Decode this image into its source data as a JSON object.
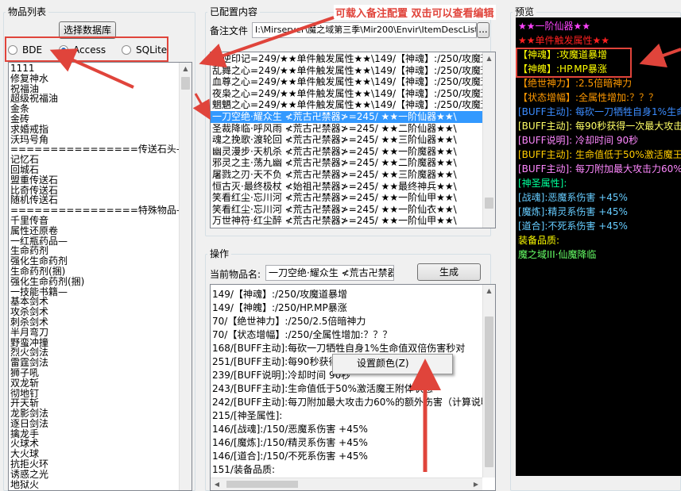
{
  "left": {
    "title": "物品列表",
    "select_db_label": "选择数据库",
    "radios": [
      {
        "label": "BDE",
        "checked": false
      },
      {
        "label": "Access",
        "checked": true
      },
      {
        "label": "SQLite",
        "checked": false
      }
    ],
    "items": [
      "1111",
      "修复神水",
      "祝福油",
      "超级祝福油",
      "金条",
      "金砖",
      "求婚戒指",
      "沃玛号角",
      "================传送石头—",
      "记忆石",
      "回城石",
      "盟重传送石",
      "比奇传送石",
      "随机传送石",
      "================特殊物品—",
      "千里传音",
      "属性还原卷",
      "一红瓶药品—",
      "生命药剂",
      "强化生命药剂",
      "生命药剂(捆)",
      "强化生命药剂(捆)",
      "一技能书籍—",
      "基本剑术",
      "攻杀剑术",
      "刺杀剑术",
      "半月弯刀",
      "野蛮冲撞",
      "烈火剑法",
      "雷霆剑法",
      "狮子吼",
      "双龙斩",
      "彻地钉",
      "开天斩",
      "龙影剑法",
      "逐日剑法",
      "擒龙手",
      "火球术",
      "大火球",
      "抗拒火环",
      "诱惑之光",
      "地狱火"
    ]
  },
  "config": {
    "title": "已配置内容",
    "annotation": "可载入备注配置 双击可以查看编辑",
    "file_label": "备注文件",
    "file_path": "I:\\Mirserver\\魔之域第三季\\Mir200\\Envir\\ItemDescList.txt",
    "browse_label": "...",
    "rows": [
      "天逆印记=249/★★单件触发属性★★\\149/【神魂】:/250/攻魔道",
      "乱舞之心=249/★★单件触发属性★★\\149/【神魂】:/250/攻魔道",
      "血尊之心=249/★★单件触发属性★★\\149/【神魂】:/250/攻魔道",
      "夜枭之心=249/★★单件触发属性★★\\149/【神魂】:/250/攻魔道",
      "魍魉之心=249/★★单件触发属性★★\\149/【神魂】:/250/攻魔道",
      "一刀空绝·耀众生 ≮荒古卍禁器≯=245/      ★★一阶仙器★★\\",
      "圣裁降临·呼风雨 ≮荒古卍禁器≯=245/      ★★二阶仙器★★\\",
      "魂之挽歌·渡轮回 ≮荒古卍禁器≯=245/      ★★三阶仙器★★\\",
      "幽灵漫步·天机杀 ≮荒古卍禁器≯=245/      ★★一阶魔器★★\\",
      "邪灵之主·荡九幽 ≮荒古卍禁器≯=245/      ★★二阶魔器★★\\",
      "屠戮之刃·天不负 ≮荒古卍禁器≯=245/      ★★三阶魔器★★\\",
      "恒古灭·最终极杖 ≮始祖卍禁器≯=245/      ★★最终神兵★★\\",
      "笑看红尘·忘川河 ≮荒古卍禁器≯=245/      ★★一阶仙甲★★\\",
      "笑看红尘·忘川河 ≮荒古卍禁器≯=245/      ★★一阶仙衣★★\\",
      "万世神符·红尘醉 ≮荒古卍禁器≯=245/      ★★一阶仙甲★★\\"
    ],
    "selected_index": 5
  },
  "ops": {
    "title": "操作",
    "current_label": "当前物品名:",
    "current_value": "一刀空绝·耀众生 ≮荒古卍禁器",
    "generate_label": "生成",
    "lines": [
      "149/【神魂】:/250/攻魔道暴增",
      "149/【神魄】:/250/HP.MP暴涨",
      "70/【绝世神力】:/250/2.5倍暗神力",
      "70/【状态增幅】:/250/全属性增加:？？？",
      "168/[BUFF主动]:每砍一刀牺牲自身1%生命值双倍伤害秒对",
      "251/[BUFF主动]:每90秒获得一次最大攻击力的效果",
      "239/[BUFF说明]:冷却时间 90秒",
      "243/[BUFF主动]:生命值低于50%激活魔王附体状态",
      "242/[BUFF主动]:每刀附加最大攻击力60%的额外伤害（计算说明",
      "215/[神圣属性]:",
      "146/[战魂]:/150/恶魔系伤害 +45%",
      "146/[魔炼]:/150/精灵系伤害 +45%",
      "146/[道合]:/150/不死系伤害 +45%",
      "151/装备品质:"
    ],
    "context_menu_item": "设置颜色(Z)"
  },
  "preview": {
    "title": "预览",
    "lines": [
      {
        "text": "      ★★一阶仙器★★",
        "color": "#ff44ff"
      },
      {
        "text": "★★单件触发属性★★",
        "color": "#ff2020"
      },
      {
        "text": "【神魂】:攻魔道暴增",
        "color": "#ffff00",
        "color2": "#00ff66"
      },
      {
        "text": "【神魄】:HP.MP暴涨",
        "color": "#ffff00",
        "color2": "#00ff66"
      },
      {
        "text": "【绝世神力】:2.5倍暗神力",
        "color": "#ff9900",
        "color2": "#00ff66"
      },
      {
        "text": "【状态增幅】:全属性增加:？？？",
        "color": "#ff9900",
        "color2": "#00ff66"
      },
      {
        "text": "[BUFF主动]: 每砍一刀牺牲自身1%生命",
        "color": "#3b8cff"
      },
      {
        "text": "[BUFF主动]: 每90秒获得一次最大攻击",
        "color": "#ffff66",
        "color2": "#ffffff"
      },
      {
        "text": "[BUFF说明]: 冷却时间 90秒",
        "color": "#ff88ff",
        "color2": "#ffffff"
      },
      {
        "text": "[BUFF主动]: 生命值低于50%激活魔王",
        "color": "#ffcc00"
      },
      {
        "text": "[BUFF主动]: 每刀附加最大攻击力60%",
        "color": "#ff88ff",
        "color2": "#ffffff"
      },
      {
        "text": "[神圣属性]:",
        "color": "#00ff99"
      },
      {
        "text": "[战魂]:恶魔系伤害 +45%",
        "color": "#66ccff",
        "color2": "#ffff88"
      },
      {
        "text": "[魔炼]:精灵系伤害 +45%",
        "color": "#66ccff",
        "color2": "#ffff88"
      },
      {
        "text": "[道合]:不死系伤害 +45%",
        "color": "#66ccff",
        "color2": "#ffff88"
      },
      {
        "text": "装备品质:",
        "color": "#ffff00"
      },
      {
        "text": "魔之域III·仙魔降临",
        "color": "#66ff66"
      }
    ]
  }
}
